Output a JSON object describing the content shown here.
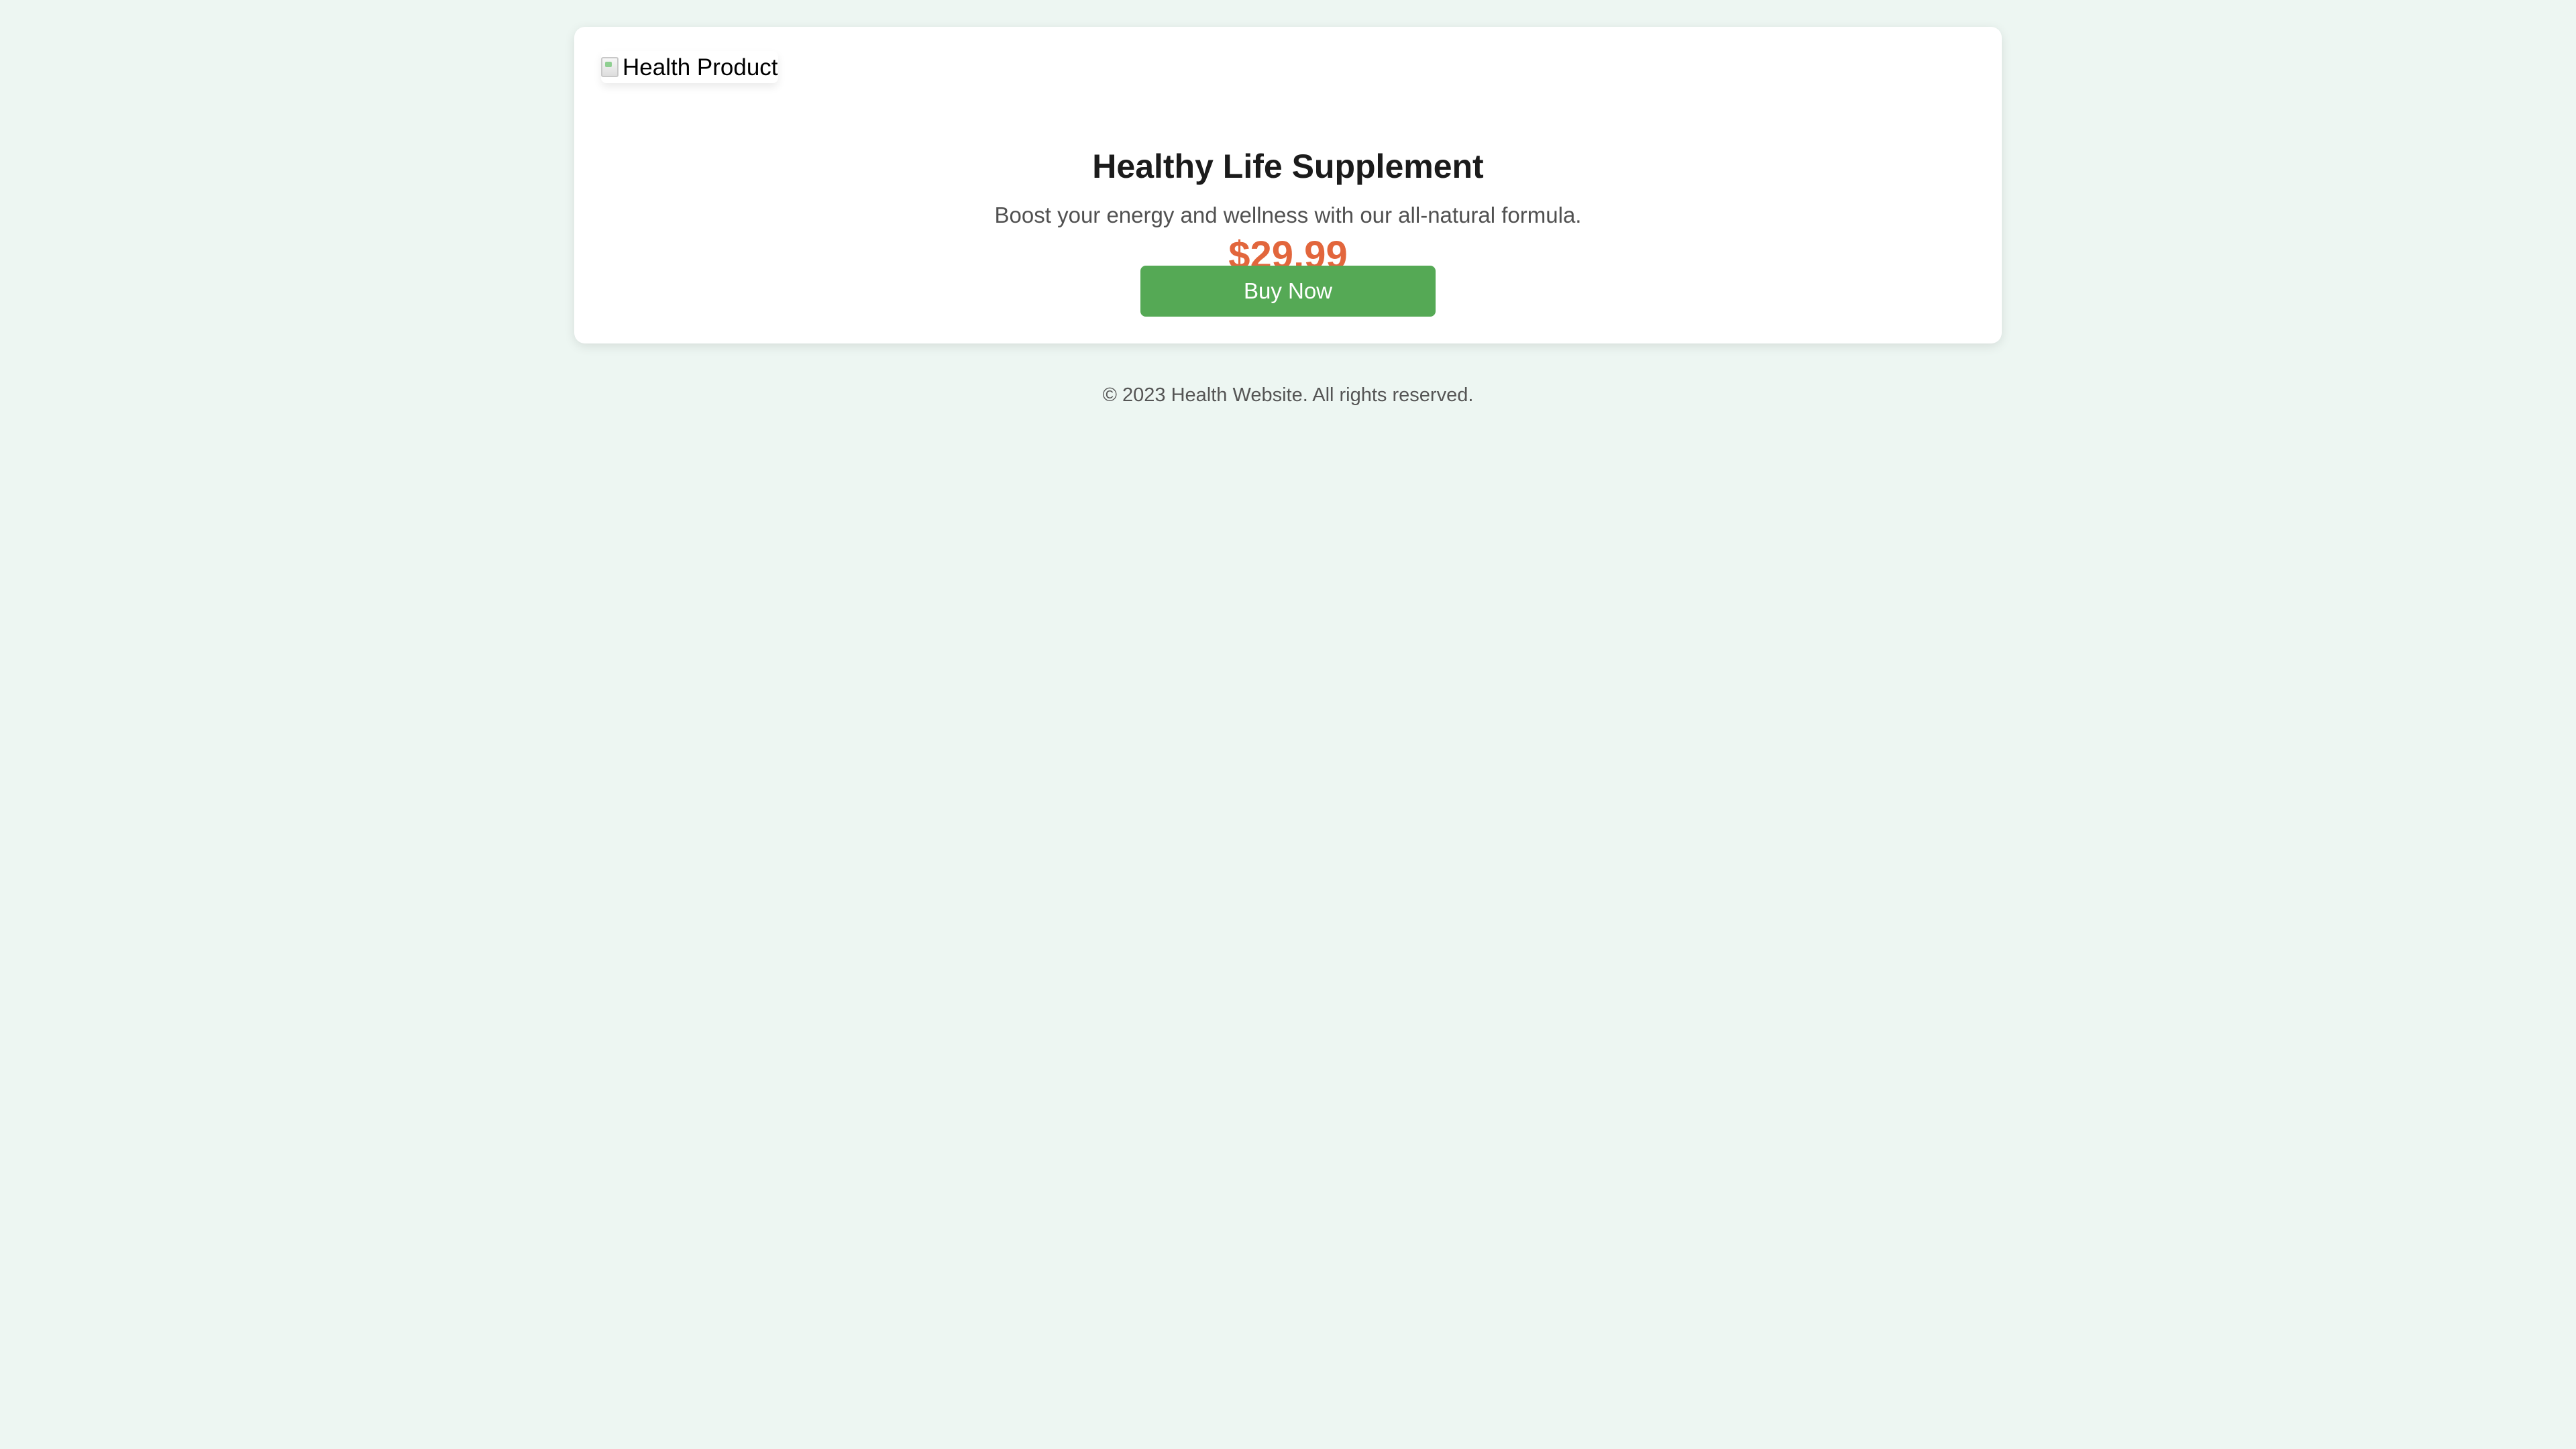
{
  "product": {
    "image_alt": "Health Product",
    "title": "Healthy Life Supplement",
    "description": "Boost your energy and wellness with our all-natural formula.",
    "price": "$29.99",
    "buy_label": "Buy Now"
  },
  "footer": {
    "text": "© 2023 Health Website. All rights reserved."
  },
  "colors": {
    "background": "#edf6f2",
    "card": "#ffffff",
    "price": "#e2663c",
    "button": "#55a955",
    "button_text": "#ffffff"
  },
  "icons": {
    "image_placeholder": "broken-image-icon"
  }
}
